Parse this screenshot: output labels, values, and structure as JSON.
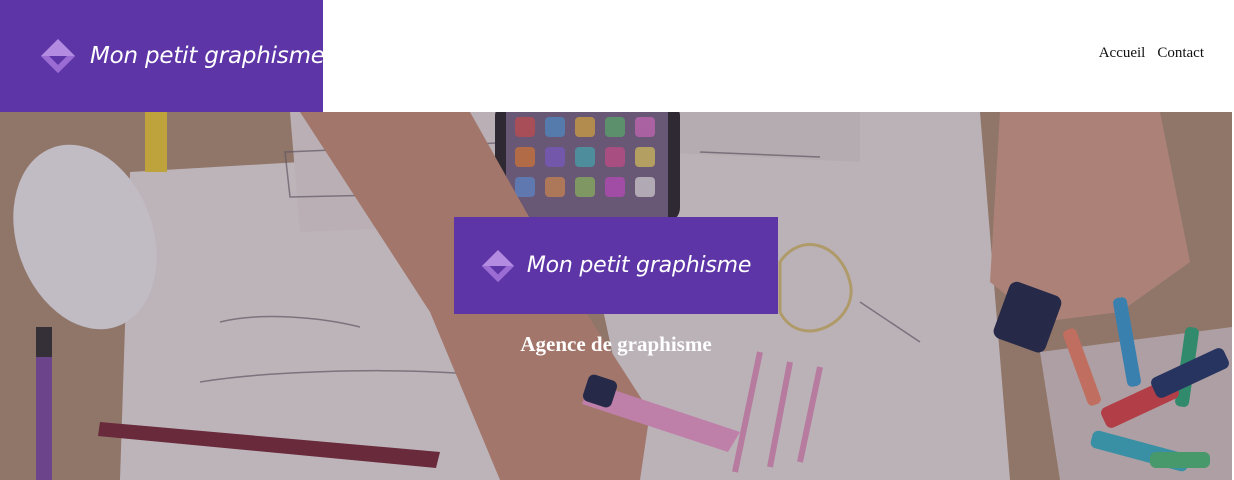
{
  "header": {
    "brand_name": "Mon petit graphisme",
    "brand_color": "#5e35a6",
    "logo_icon": "diamond-logo-icon",
    "nav": [
      {
        "label": "Accueil"
      },
      {
        "label": "Contact"
      }
    ]
  },
  "hero": {
    "card_brand_name": "Mon petit graphisme",
    "subtitle": "Agence de graphisme",
    "background": "desk-with-sketches-photo"
  }
}
